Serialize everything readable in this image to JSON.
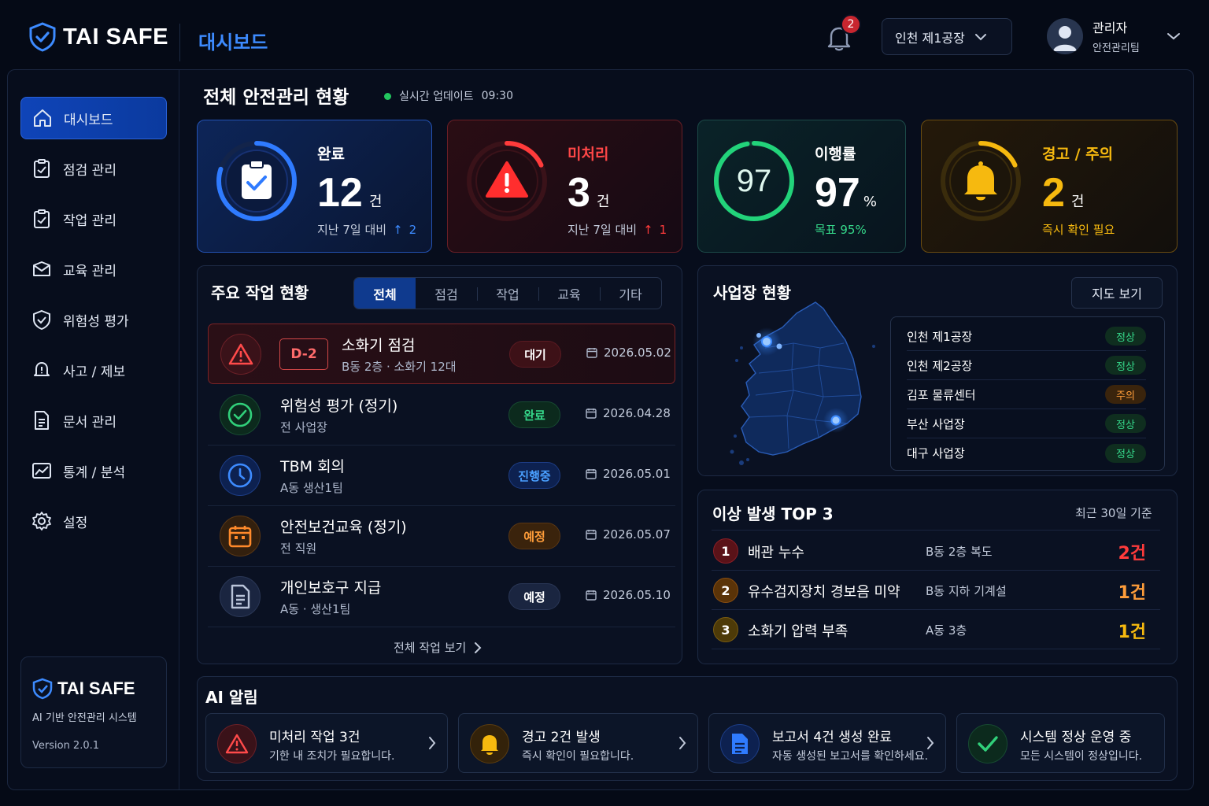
{
  "topbar": {
    "brand": "TAI SAFE",
    "page": "대시보드",
    "notifications": "2",
    "site": "인천 제1공장",
    "user_name": "관리자",
    "user_role": "안전관리팀"
  },
  "sidebar": {
    "items": [
      {
        "label": "대시보드",
        "icon": "home-icon"
      },
      {
        "label": "점검 관리",
        "icon": "clipboard-check-icon"
      },
      {
        "label": "작업 관리",
        "icon": "clipboard-check-icon"
      },
      {
        "label": "교육 관리",
        "icon": "education-icon"
      },
      {
        "label": "위험성 평가",
        "icon": "shield-check-icon"
      },
      {
        "label": "사고 / 제보",
        "icon": "alert-bell-icon"
      },
      {
        "label": "문서 관리",
        "icon": "document-icon"
      },
      {
        "label": "통계 / 분석",
        "icon": "chart-icon"
      },
      {
        "label": "설정",
        "icon": "gear-icon"
      }
    ],
    "card": {
      "brand": "TAI SAFE",
      "subtitle": "AI 기반 안전관리 시스템",
      "version": "Version 2.0.1"
    }
  },
  "header": {
    "title": "전체 안전관리 현황",
    "live_label": "실시간 업데이트",
    "live_time": "09:30"
  },
  "stats": {
    "done": {
      "label": "완료",
      "value": "12",
      "unit": "건",
      "sub": "지난 7일 대비",
      "delta": "2",
      "ring": 0.8,
      "color": "#2f7bff"
    },
    "pending": {
      "label": "미처리",
      "value": "3",
      "unit": "건",
      "sub": "지난 7일 대비",
      "delta": "1",
      "ring": 0.18,
      "color": "#ff3b3b"
    },
    "rate": {
      "label": "이행률",
      "value": "97",
      "unit": "%",
      "ring_value": "97",
      "sub": "목표 95%",
      "ring": 0.97,
      "color": "#22d37a"
    },
    "warn": {
      "label": "경고 / 주의",
      "value": "2",
      "unit": "건",
      "sub": "즉시 확인 필요",
      "ring": 0.18,
      "color": "#f6b90f"
    }
  },
  "tasks": {
    "title": "주요 작업 현황",
    "tabs": [
      "전체",
      "점검",
      "작업",
      "교육",
      "기타"
    ],
    "items": [
      {
        "dday": "D-2",
        "title": "소화기 점검",
        "sub": "B동 2층 · 소화기 12대",
        "status": "대기",
        "date": "2026.05.02",
        "icon": "warning-icon"
      },
      {
        "title": "위험성 평가 (정기)",
        "sub": "전 사업장",
        "status": "완료",
        "date": "2026.04.28",
        "icon": "check-circle-icon"
      },
      {
        "title": "TBM 회의",
        "sub": "A동 생산1팀",
        "status": "진행중",
        "date": "2026.05.01",
        "icon": "clock-icon"
      },
      {
        "title": "안전보건교육 (정기)",
        "sub": "전 직원",
        "status": "예정",
        "date": "2026.05.07",
        "icon": "calendar-icon"
      },
      {
        "title": "개인보호구 지급",
        "sub": "A동 · 생산1팀",
        "status": "예정",
        "date": "2026.05.10",
        "icon": "document-icon"
      }
    ],
    "more": "전체 작업 보기"
  },
  "sites": {
    "title": "사업장 현황",
    "map_button": "지도 보기",
    "items": [
      {
        "name": "인천 제1공장",
        "status": "정상"
      },
      {
        "name": "인천 제2공장",
        "status": "정상"
      },
      {
        "name": "김포 물류센터",
        "status": "주의"
      },
      {
        "name": "부산 사업장",
        "status": "정상"
      },
      {
        "name": "대구 사업장",
        "status": "정상"
      }
    ]
  },
  "top3": {
    "title": "이상 발생 TOP 3",
    "period": "최근 30일 기준",
    "items": [
      {
        "rank": "1",
        "name": "배관 누수",
        "location": "B동 2층 복도",
        "count": "2건"
      },
      {
        "rank": "2",
        "name": "유수검지장치 경보음 미약",
        "location": "B동 지하 기계설",
        "count": "1건"
      },
      {
        "rank": "3",
        "name": "소화기 압력 부족",
        "location": "A동 3층",
        "count": "1건"
      }
    ]
  },
  "ai": {
    "title": "AI 알림",
    "items": [
      {
        "title": "미처리 작업 3건",
        "sub": "기한 내 조치가 필요합니다."
      },
      {
        "title": "경고 2건 발생",
        "sub": "즉시 확인이 필요합니다."
      },
      {
        "title": "보고서 4건 생성 완료",
        "sub": "자동 생성된 보고서를 확인하세요."
      },
      {
        "title": "시스템 정상 운영 중",
        "sub": "모든 시스템이 정상입니다."
      }
    ]
  }
}
